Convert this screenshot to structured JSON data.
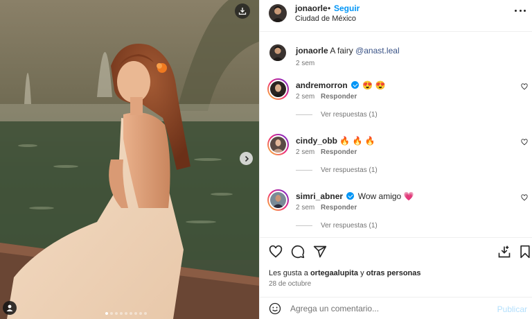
{
  "post": {
    "username": "jonaorle",
    "separator": "•",
    "follow_label": "Seguir",
    "location": "Ciudad de México",
    "caption_text": "A fairy",
    "caption_mention": "@anast.leal",
    "caption_time": "2 sem"
  },
  "comments": [
    {
      "username": "andremorron",
      "verified": true,
      "text": "😍 😍",
      "time": "2 sem",
      "reply_label": "Responder",
      "view_replies": "Ver respuestas (1)"
    },
    {
      "username": "cindy_obb",
      "verified": false,
      "text": "🔥 🔥 🔥",
      "time": "2 sem",
      "reply_label": "Responder",
      "view_replies": "Ver respuestas (1)"
    },
    {
      "username": "simri_abner",
      "verified": true,
      "text": "Wow amigo 💗",
      "time": "2 sem",
      "reply_label": "Responder",
      "view_replies": "Ver respuestas (1)"
    }
  ],
  "likes": {
    "prefix": "Les gusta a",
    "user": "ortegaalupita",
    "conjunction": "y",
    "others": "otras personas"
  },
  "date": "28 de octubre",
  "add_comment": {
    "placeholder": "Agrega un comentario...",
    "publish_label": "Publicar"
  },
  "carousel": {
    "count": 9,
    "active_index": 0
  },
  "icons": {
    "download": "download-icon",
    "next": "chevron-right-icon",
    "user_tag": "user-tag-icon",
    "more": "more-options-icon",
    "like": "heart-icon",
    "comment": "comment-icon",
    "share": "share-icon",
    "save": "bookmark-icon",
    "emoji": "emoji-icon"
  },
  "colors": {
    "accent": "#0095f6",
    "text": "#262626",
    "secondary_text": "#737373",
    "mention": "#385185",
    "publish_disabled": "#b2dffc"
  }
}
